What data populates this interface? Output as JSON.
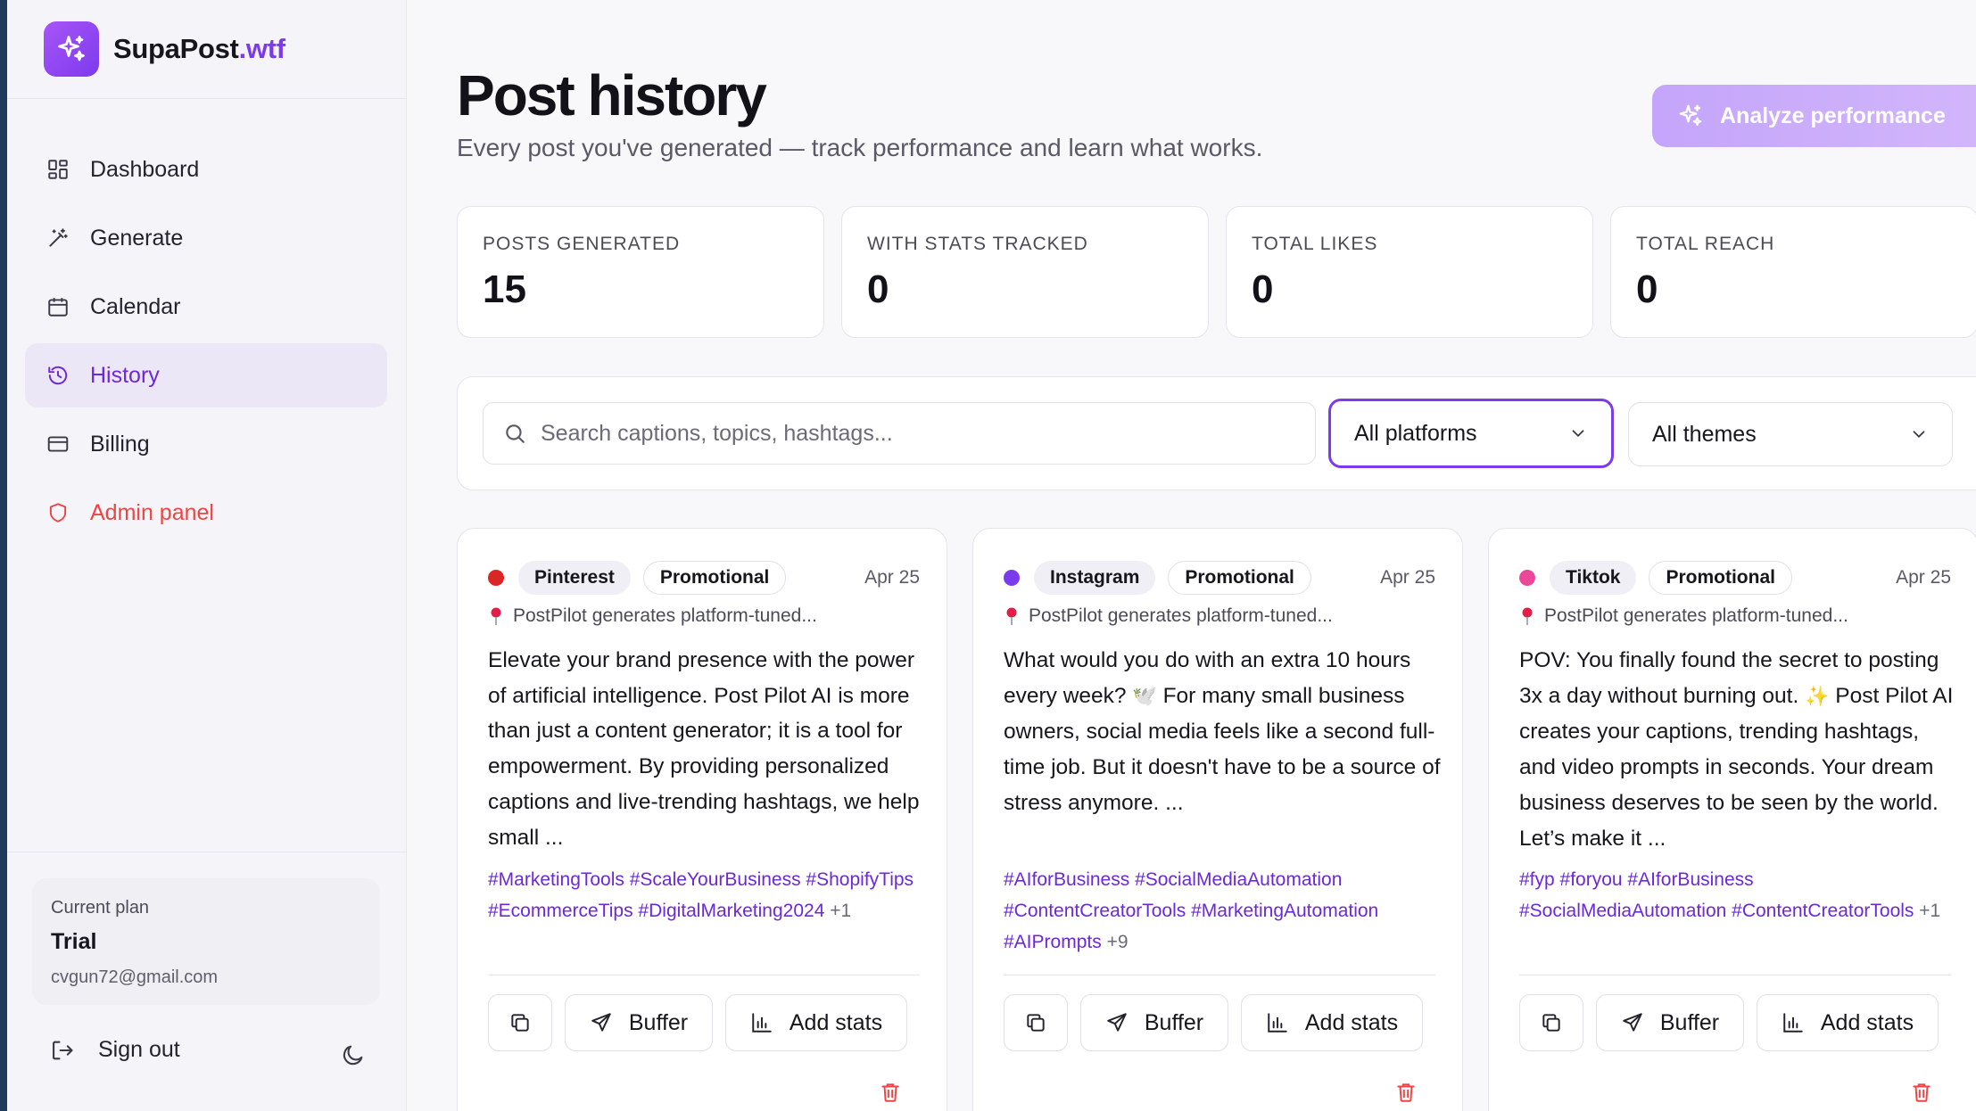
{
  "brand": {
    "name": "SupaPost",
    "tld": ".wtf"
  },
  "nav": [
    {
      "label": "Dashboard",
      "icon": "dashboard-grid-icon"
    },
    {
      "label": "Generate",
      "icon": "magic-wand-icon"
    },
    {
      "label": "Calendar",
      "icon": "calendar-icon"
    },
    {
      "label": "History",
      "icon": "history-icon",
      "active": true
    },
    {
      "label": "Billing",
      "icon": "credit-card-icon"
    },
    {
      "label": "Admin panel",
      "icon": "shield-icon"
    }
  ],
  "plan": {
    "label": "Current plan",
    "name": "Trial",
    "email": "cvgun72@gmail.com"
  },
  "signout": {
    "label": "Sign out"
  },
  "header": {
    "title": "Post history",
    "subtitle": "Every post you've generated — track performance and learn what works.",
    "analyze_label": "Analyze performance"
  },
  "stats": [
    {
      "label": "POSTS GENERATED",
      "value": "15"
    },
    {
      "label": "WITH STATS TRACKED",
      "value": "0"
    },
    {
      "label": "TOTAL LIKES",
      "value": "0"
    },
    {
      "label": "TOTAL REACH",
      "value": "0"
    }
  ],
  "filters": {
    "search_placeholder": "Search captions, topics, hashtags...",
    "platform": "All platforms",
    "theme": "All themes"
  },
  "colors": {
    "accent": "#7c3aed",
    "pinterest": "#dc2626",
    "instagram": "#7c3aed",
    "tiktok": "#ec4899",
    "danger": "#ef4444"
  },
  "posts": [
    {
      "platform": "Pinterest",
      "theme": "Promotional",
      "date": "Apr 25",
      "topic": "PostPilot generates platform-tuned...",
      "body": "Elevate your brand presence with the power of artificial intelligence. Post Pilot AI is more than just a content generator; it is a tool for empowerment. By providing personalized captions and live-trending hashtags, we help small ...",
      "hashtags": "#MarketingTools #ScaleYourBusiness #ShopifyTips #EcommerceTips #DigitalMarketing2024",
      "more": "+1"
    },
    {
      "platform": "Instagram",
      "theme": "Promotional",
      "date": "Apr 25",
      "topic": "PostPilot generates platform-tuned...",
      "body_a": "What would you do with an extra 10 hours every week?",
      "body_emoji": "🕊️",
      "body_b": "For many small business owners, social media feels like a second full-time job. But it doesn't have to be a source of stress anymore. ...",
      "hashtags": "#AIforBusiness #SocialMediaAutomation #ContentCreatorTools #MarketingAutomation #AIPrompts",
      "more": "+9"
    },
    {
      "platform": "Tiktok",
      "theme": "Promotional",
      "date": "Apr 25",
      "topic": "PostPilot generates platform-tuned...",
      "body_a": "POV: You finally found the secret to posting 3x a day without burning out.",
      "body_emoji": "✨",
      "body_b": "Post Pilot AI creates your captions, trending hashtags, and video prompts in seconds. Your dream business deserves to be seen by the world. Let’s make it ...",
      "hashtags": "#fyp #foryou #AIforBusiness #SocialMediaAutomation #ContentCreatorTools",
      "more": "+1"
    }
  ],
  "actions": {
    "buffer": "Buffer",
    "stats": "Add stats"
  }
}
